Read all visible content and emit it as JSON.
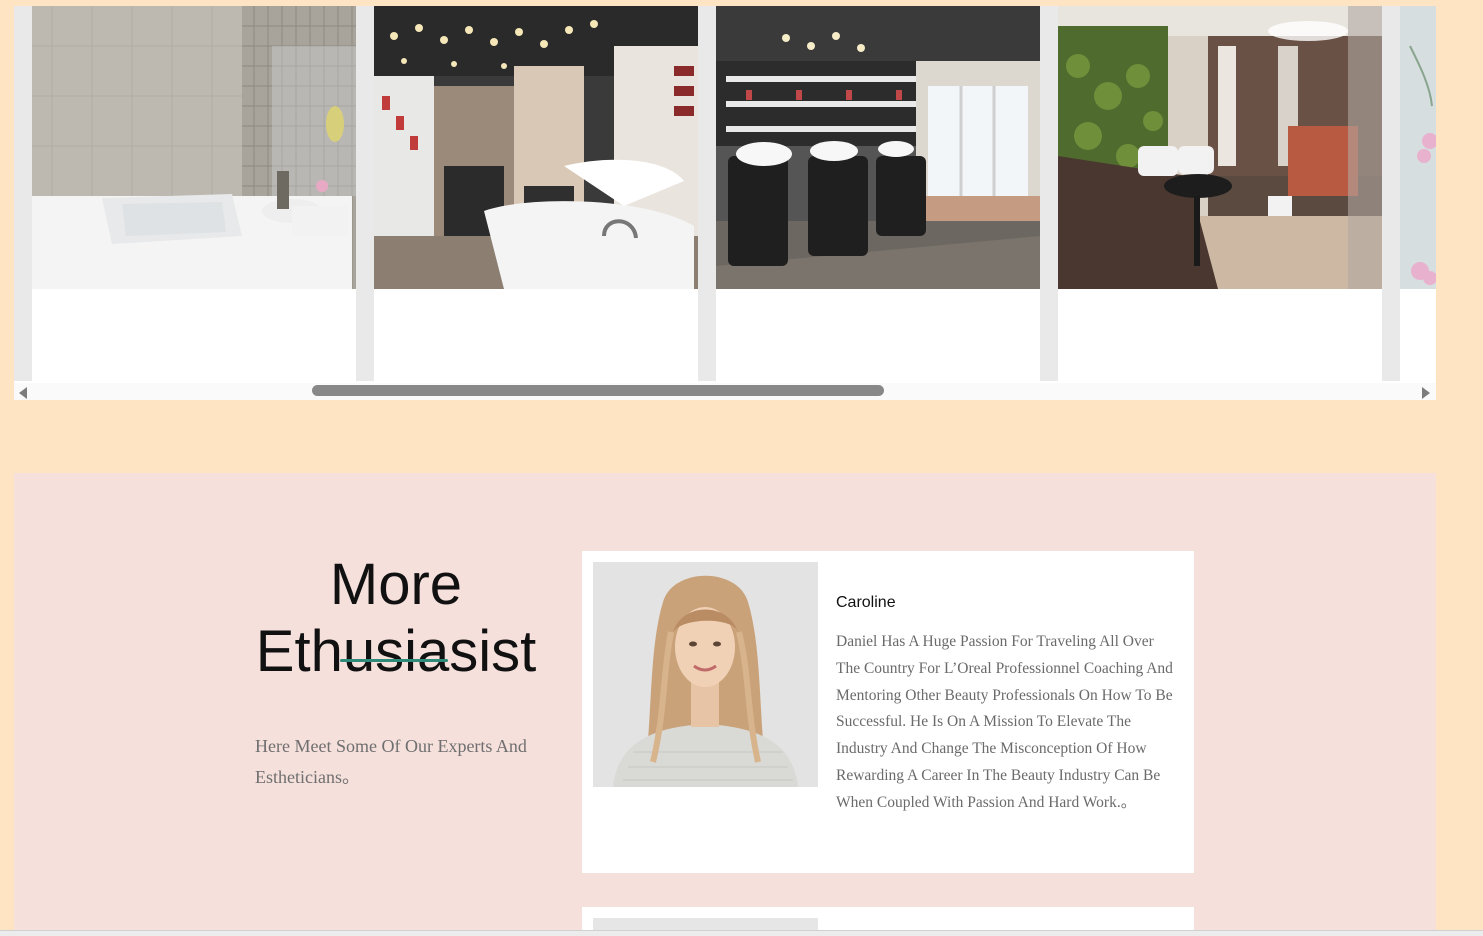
{
  "gallery": {
    "cards": [
      {
        "photo_icon": "spa-bathtub-photo"
      },
      {
        "photo_icon": "salon-interior-photo"
      },
      {
        "photo_icon": "wash-station-photo"
      },
      {
        "photo_icon": "green-wall-salon-photo"
      },
      {
        "photo_icon": "flower-photo"
      }
    ],
    "scrollbar": {
      "left_arrow_icon": "triangle-left-icon",
      "right_arrow_icon": "triangle-right-icon"
    }
  },
  "experts": {
    "title_line1": "More",
    "title_line2": "Ethusiasist",
    "intro": "Here Meet Some Of Our Experts And Estheticians。",
    "members": [
      {
        "name": "Caroline",
        "bio": "Daniel Has A Huge Passion For Traveling All Over The Country For L’Oreal Professionnel Coaching And Mentoring Other Beauty Professionals On How To Be Successful. He Is On A Mission To Elevate The Industry And Change The Misconception Of How Rewarding A Career In The Beauty Industry Can Be When Coupled With Passion And Hard Work.。"
      }
    ]
  },
  "colors": {
    "page_background": "#ffe4c3",
    "section_background": "#f5e0dc",
    "title_accent": "#2e8b7a",
    "scroll_thumb": "#888888"
  }
}
